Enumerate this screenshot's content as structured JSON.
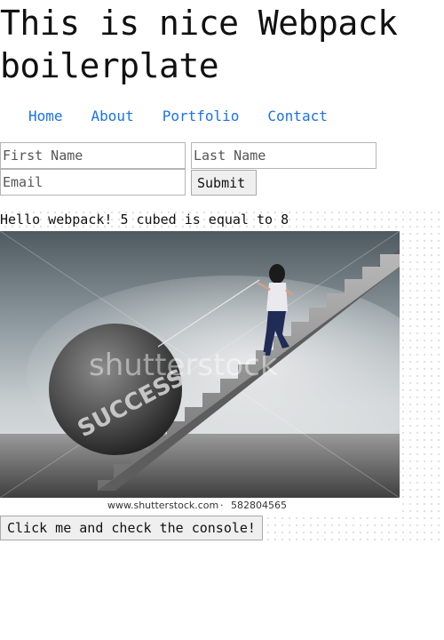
{
  "header": {
    "title": "This is nice Webpack boilerplate"
  },
  "nav": {
    "items": [
      {
        "label": "Home"
      },
      {
        "label": "About"
      },
      {
        "label": "Portfolio"
      },
      {
        "label": "Contact"
      }
    ],
    "link_color": "#1a73e8"
  },
  "form": {
    "first_name_placeholder": "First Name",
    "last_name_placeholder": "Last Name",
    "email_placeholder": "Email",
    "submit_label": "Submit"
  },
  "main": {
    "hello_text": "Hello webpack! 5 cubed is equal to 8",
    "image": {
      "boulder_text": "SUCCESS",
      "watermark": "shutterstock",
      "footer_site": "www.shutterstock.com",
      "footer_separator": "·",
      "footer_id": "582804565"
    },
    "console_button_label": "Click me and check the console!"
  }
}
